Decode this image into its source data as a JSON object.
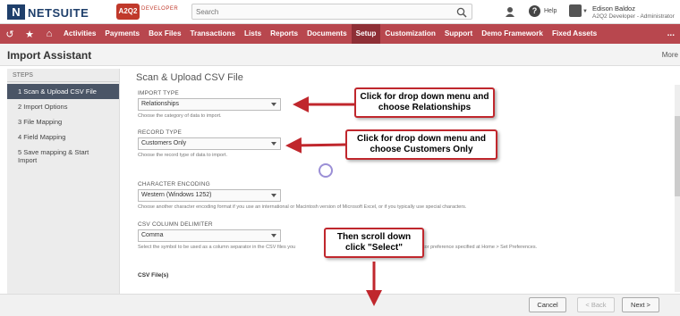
{
  "topbar": {
    "logo_mark": "N",
    "logo_text": "NETSUITE",
    "brand_badge": "A2Q2",
    "brand_text": "DEVELOPER",
    "search_placeholder": "Search",
    "help_label": "Help",
    "user_name": "Edison Baldoz",
    "user_role": "A2Q2 Developer - Administrator"
  },
  "nav": {
    "items": [
      "Activities",
      "Payments",
      "Box Files",
      "Transactions",
      "Lists",
      "Reports",
      "Documents",
      "Setup",
      "Customization",
      "Support",
      "Demo Framework",
      "Fixed Assets"
    ],
    "active": "Setup",
    "more": "..."
  },
  "page": {
    "title": "Import Assistant",
    "more_label": "More"
  },
  "steps": {
    "header": "STEPS",
    "items": [
      "1 Scan & Upload CSV File",
      "2 Import Options",
      "3 File Mapping",
      "4 Field Mapping",
      "5 Save mapping & Start Import"
    ]
  },
  "form": {
    "title": "Scan & Upload CSV File",
    "import_type": {
      "label": "IMPORT TYPE",
      "value": "Relationships",
      "help": "Choose the category of data to import."
    },
    "record_type": {
      "label": "RECORD TYPE",
      "value": "Customers Only",
      "help": "Choose the record type of data to import."
    },
    "encoding": {
      "label": "CHARACTER ENCODING",
      "value": "Western (Windows 1252)",
      "help": "Choose another character encoding format if you use an international or Macintosh version of Microsoft Excel, or if you typically use special characters."
    },
    "delimiter": {
      "label": "CSV COLUMN DELIMITER",
      "value": "Comma",
      "help_a": "Select the symbol to be used as a column separator in the CSV files you",
      "help_b": "parator preference specified at Home > Set Preferences."
    },
    "csv_files_label": "CSV File(s)"
  },
  "footer": {
    "cancel": "Cancel",
    "back": "< Back",
    "next": "Next >"
  },
  "callouts": {
    "c1": "Click for drop down menu and choose Relationships",
    "c2": "Click for drop down menu and choose Customers Only",
    "c3": "Then scroll down click \"Select\""
  },
  "colors": {
    "nav": "#b8474e",
    "nav_active": "#8e2f36",
    "brand": "#1f3f6b",
    "callout_border": "#c0272d"
  }
}
